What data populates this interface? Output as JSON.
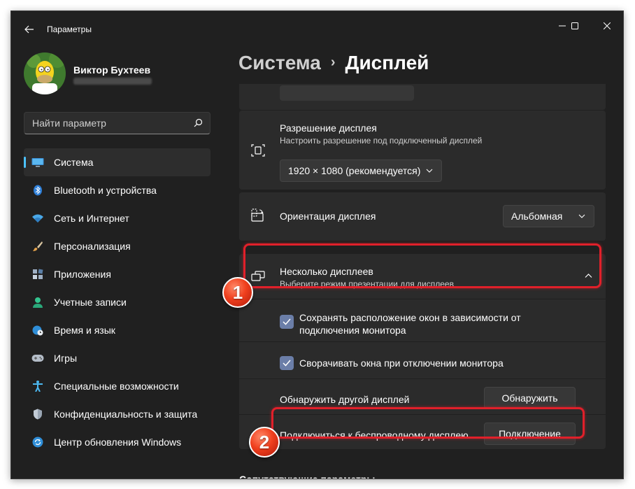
{
  "window": {
    "title": "Параметры",
    "controls": {
      "minimize_icon": "minimize-icon",
      "maximize_icon": "maximize-icon",
      "close_icon": "close-icon"
    }
  },
  "user": {
    "name": "Виктор Бухтеев"
  },
  "search": {
    "placeholder": "Найти параметр"
  },
  "sidebar": {
    "items": [
      {
        "label": "Система",
        "icon": "monitor-icon",
        "active": true
      },
      {
        "label": "Bluetooth и устройства",
        "icon": "bluetooth-icon"
      },
      {
        "label": "Сеть и Интернет",
        "icon": "wifi-icon"
      },
      {
        "label": "Персонализация",
        "icon": "brush-icon"
      },
      {
        "label": "Приложения",
        "icon": "apps-icon"
      },
      {
        "label": "Учетные записи",
        "icon": "account-icon"
      },
      {
        "label": "Время и язык",
        "icon": "globe-clock-icon"
      },
      {
        "label": "Игры",
        "icon": "gamepad-icon"
      },
      {
        "label": "Специальные возможности",
        "icon": "accessibility-icon"
      },
      {
        "label": "Конфиденциальность и защита",
        "icon": "shield-icon"
      },
      {
        "label": "Центр обновления Windows",
        "icon": "update-icon"
      }
    ]
  },
  "breadcrumb": {
    "parent": "Система",
    "separator": "›",
    "current": "Дисплей"
  },
  "display": {
    "resolution": {
      "title": "Разрешение дисплея",
      "subtitle": "Настроить разрешение под подключенный дисплей",
      "value": "1920 × 1080 (рекомендуется)"
    },
    "orientation": {
      "title": "Ориентация дисплея",
      "value": "Альбомная"
    },
    "multiple": {
      "title": "Несколько дисплеев",
      "subtitle": "Выберите режим презентации для дисплеев",
      "expanded": true,
      "remember_windows": {
        "label": "Сохранять расположение окон в зависимости от подключения монитора",
        "checked": true
      },
      "minimize_windows": {
        "label": "Сворачивать окна при отключении монитора",
        "checked": true
      },
      "detect": {
        "label": "Обнаружить другой дисплей",
        "button": "Обнаружить"
      },
      "wireless": {
        "label": "Подключиться к беспроводному дисплею",
        "button": "Подключение"
      }
    },
    "related_title": "Сопутствующие параметры"
  },
  "annotations": {
    "marker1": "1",
    "marker2": "2",
    "highlight_color": "#e0202a"
  },
  "colors": {
    "accent": "#4cc2ff",
    "window_bg": "#202020",
    "card_bg": "#2b2b2b",
    "checkbox": "#6b7ea8"
  }
}
